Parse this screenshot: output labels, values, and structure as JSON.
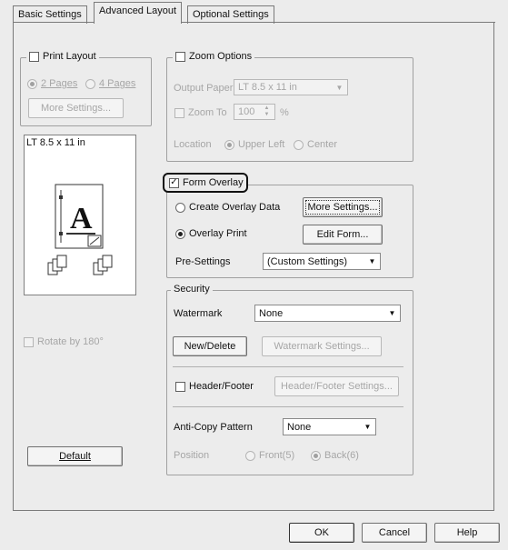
{
  "tabs": [
    "Basic Settings",
    "Advanced Layout",
    "Optional Settings"
  ],
  "print_layout": {
    "label": "Print Layout",
    "options": [
      "2 Pages",
      "4 Pages"
    ],
    "more_settings": "More Settings..."
  },
  "preview": {
    "paper": "LT 8.5 x 11 in",
    "letter": "A"
  },
  "rotate_label": "Rotate by 180°",
  "default_button": "Default",
  "zoom": {
    "label": "Zoom Options",
    "output_paper_label": "Output Paper",
    "output_paper_value": "LT 8.5 x 11 in",
    "zoom_to_label": "Zoom To",
    "zoom_value": "100",
    "percent": "%",
    "location_label": "Location",
    "location_options": [
      "Upper Left",
      "Center"
    ]
  },
  "form_overlay": {
    "label": "Form Overlay",
    "create_label": "Create Overlay Data",
    "more_settings": "More Settings...",
    "overlay_print_label": "Overlay Print",
    "edit_form": "Edit Form...",
    "presettings_label": "Pre-Settings",
    "presettings_value": "(Custom Settings)"
  },
  "security": {
    "label": "Security",
    "watermark_label": "Watermark",
    "watermark_value": "None",
    "new_delete": "New/Delete",
    "watermark_settings": "Watermark Settings...",
    "header_footer_label": "Header/Footer",
    "header_footer_settings": "Header/Footer Settings...",
    "anticopy_label": "Anti-Copy Pattern",
    "anticopy_value": "None",
    "position_label": "Position",
    "position_options": [
      "Front(5)",
      "Back(6)"
    ]
  },
  "footer_buttons": [
    "OK",
    "Cancel",
    "Help"
  ]
}
